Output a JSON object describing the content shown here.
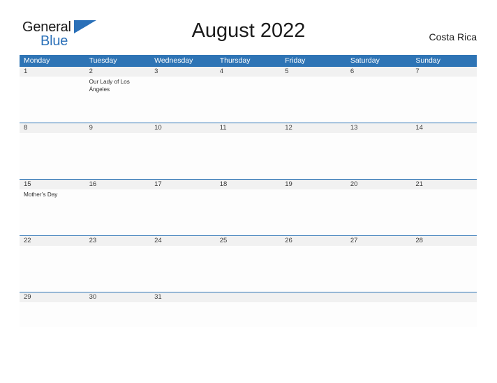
{
  "brand": {
    "name_part1": "General",
    "name_part2": "Blue",
    "flag_icon": "flag-triangle-icon",
    "accent_color": "#2a70b8"
  },
  "header": {
    "title": "August 2022",
    "locale": "Costa Rica"
  },
  "colors": {
    "header_band": "#2e74b5",
    "number_band": "#f1f1f1",
    "row_rule": "#2e74b5",
    "text": "#2b2b2b"
  },
  "calendar": {
    "month": "August",
    "year": "2022",
    "day_headers": [
      "Monday",
      "Tuesday",
      "Wednesday",
      "Thursday",
      "Friday",
      "Saturday",
      "Sunday"
    ],
    "weeks": [
      {
        "days": [
          {
            "number": "1",
            "events": []
          },
          {
            "number": "2",
            "events": [
              "Our Lady of Los Ángeles"
            ]
          },
          {
            "number": "3",
            "events": []
          },
          {
            "number": "4",
            "events": []
          },
          {
            "number": "5",
            "events": []
          },
          {
            "number": "6",
            "events": []
          },
          {
            "number": "7",
            "events": []
          }
        ]
      },
      {
        "days": [
          {
            "number": "8",
            "events": []
          },
          {
            "number": "9",
            "events": []
          },
          {
            "number": "10",
            "events": []
          },
          {
            "number": "11",
            "events": []
          },
          {
            "number": "12",
            "events": []
          },
          {
            "number": "13",
            "events": []
          },
          {
            "number": "14",
            "events": []
          }
        ]
      },
      {
        "days": [
          {
            "number": "15",
            "events": [
              "Mother’s Day"
            ]
          },
          {
            "number": "16",
            "events": []
          },
          {
            "number": "17",
            "events": []
          },
          {
            "number": "18",
            "events": []
          },
          {
            "number": "19",
            "events": []
          },
          {
            "number": "20",
            "events": []
          },
          {
            "number": "21",
            "events": []
          }
        ]
      },
      {
        "days": [
          {
            "number": "22",
            "events": []
          },
          {
            "number": "23",
            "events": []
          },
          {
            "number": "24",
            "events": []
          },
          {
            "number": "25",
            "events": []
          },
          {
            "number": "26",
            "events": []
          },
          {
            "number": "27",
            "events": []
          },
          {
            "number": "28",
            "events": []
          }
        ]
      },
      {
        "days": [
          {
            "number": "29",
            "events": []
          },
          {
            "number": "30",
            "events": []
          },
          {
            "number": "31",
            "events": []
          },
          {
            "number": "",
            "events": []
          },
          {
            "number": "",
            "events": []
          },
          {
            "number": "",
            "events": []
          },
          {
            "number": "",
            "events": []
          }
        ]
      }
    ]
  }
}
